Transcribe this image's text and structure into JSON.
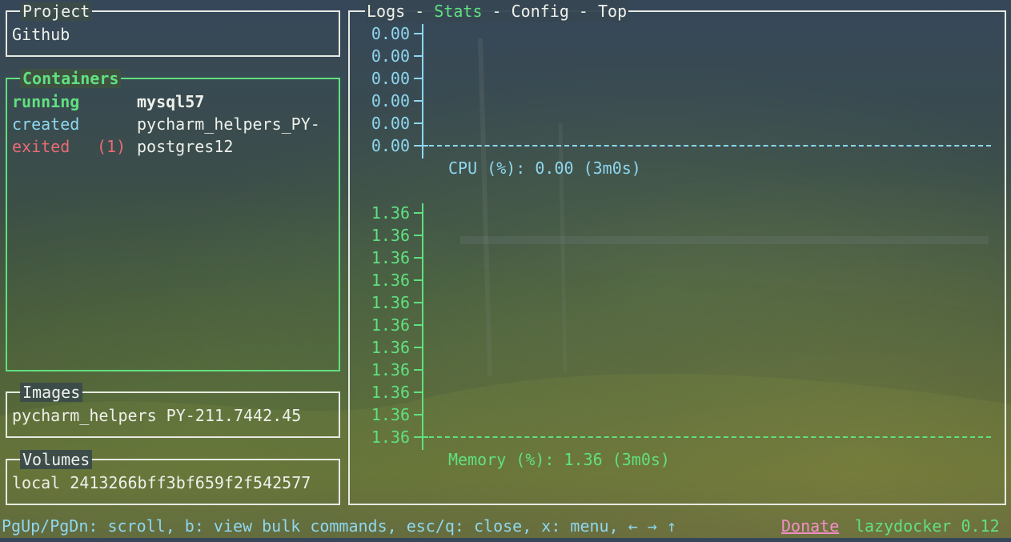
{
  "colors": {
    "active_border": "#60e080",
    "cpu_series": "#8ed7ef",
    "memory_series": "#60e080",
    "exited_status": "#ea6b75",
    "donate_link": "#f28fc6"
  },
  "project": {
    "title": "Project",
    "name": "Github"
  },
  "containers": {
    "title": "Containers",
    "items": [
      {
        "status": "running",
        "count": "",
        "name": "mysql57"
      },
      {
        "status": "created",
        "count": "",
        "name": "pycharm_helpers_PY-"
      },
      {
        "status": "exited",
        "count": "(1)",
        "name": "postgres12"
      }
    ]
  },
  "images": {
    "title": "Images",
    "items": [
      {
        "label": "pycharm_helpers PY-211.7442.45"
      }
    ]
  },
  "volumes": {
    "title": "Volumes",
    "items": [
      {
        "label": "local 2413266bff3bf659f2f542577"
      }
    ]
  },
  "main": {
    "tabs": [
      {
        "label": "Logs",
        "selected": false
      },
      {
        "label": "Stats",
        "selected": true
      },
      {
        "label": "Config",
        "selected": false
      },
      {
        "label": "Top",
        "selected": false
      }
    ],
    "separator": " - "
  },
  "chart_data": [
    {
      "type": "line",
      "title": "CPU (%): 0.00 (3m0s)",
      "ticks": [
        "0.00",
        "0.00",
        "0.00",
        "0.00",
        "0.00",
        "0.00"
      ],
      "series": [
        {
          "values": [
            0.0
          ]
        }
      ],
      "ylim": [
        0.0,
        0.0
      ]
    },
    {
      "type": "line",
      "title": "Memory (%): 1.36 (3m0s)",
      "ticks": [
        "1.36",
        "1.36",
        "1.36",
        "1.36",
        "1.36",
        "1.36",
        "1.36",
        "1.36",
        "1.36",
        "1.36",
        "1.36"
      ],
      "series": [
        {
          "values": [
            1.36
          ]
        }
      ],
      "ylim": [
        1.36,
        1.36
      ]
    }
  ],
  "status_bar": {
    "help": "PgUp/PgDn: scroll, b: view bulk commands, esc/q: close, x: menu, ← → ↑",
    "donate": "Donate",
    "version": "lazydocker 0.12"
  }
}
